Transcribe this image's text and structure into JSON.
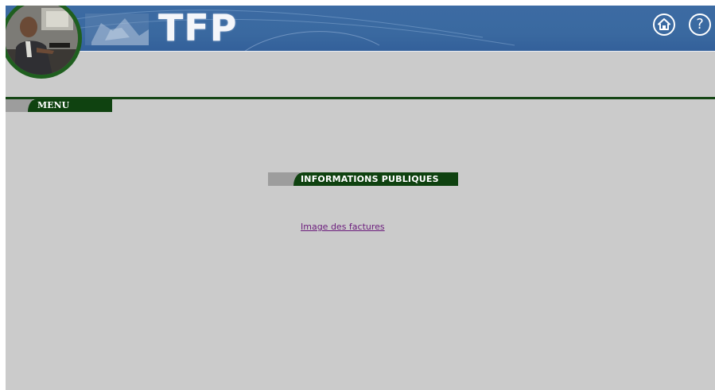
{
  "header": {
    "brand_title": "TFP",
    "home_icon": "home-icon",
    "help_icon": "help-icon",
    "help_glyph": "?"
  },
  "sidebar": {
    "menu_label": "MENU"
  },
  "main": {
    "section_title": "INFORMATIONS PUBLIQUES",
    "links": [
      "Image des factures"
    ]
  },
  "colors": {
    "banner_blue": "#3a69a0",
    "dark_green": "#0f4210",
    "page_grey": "#cbcbcb",
    "link_purple": "#6b1c7c"
  }
}
